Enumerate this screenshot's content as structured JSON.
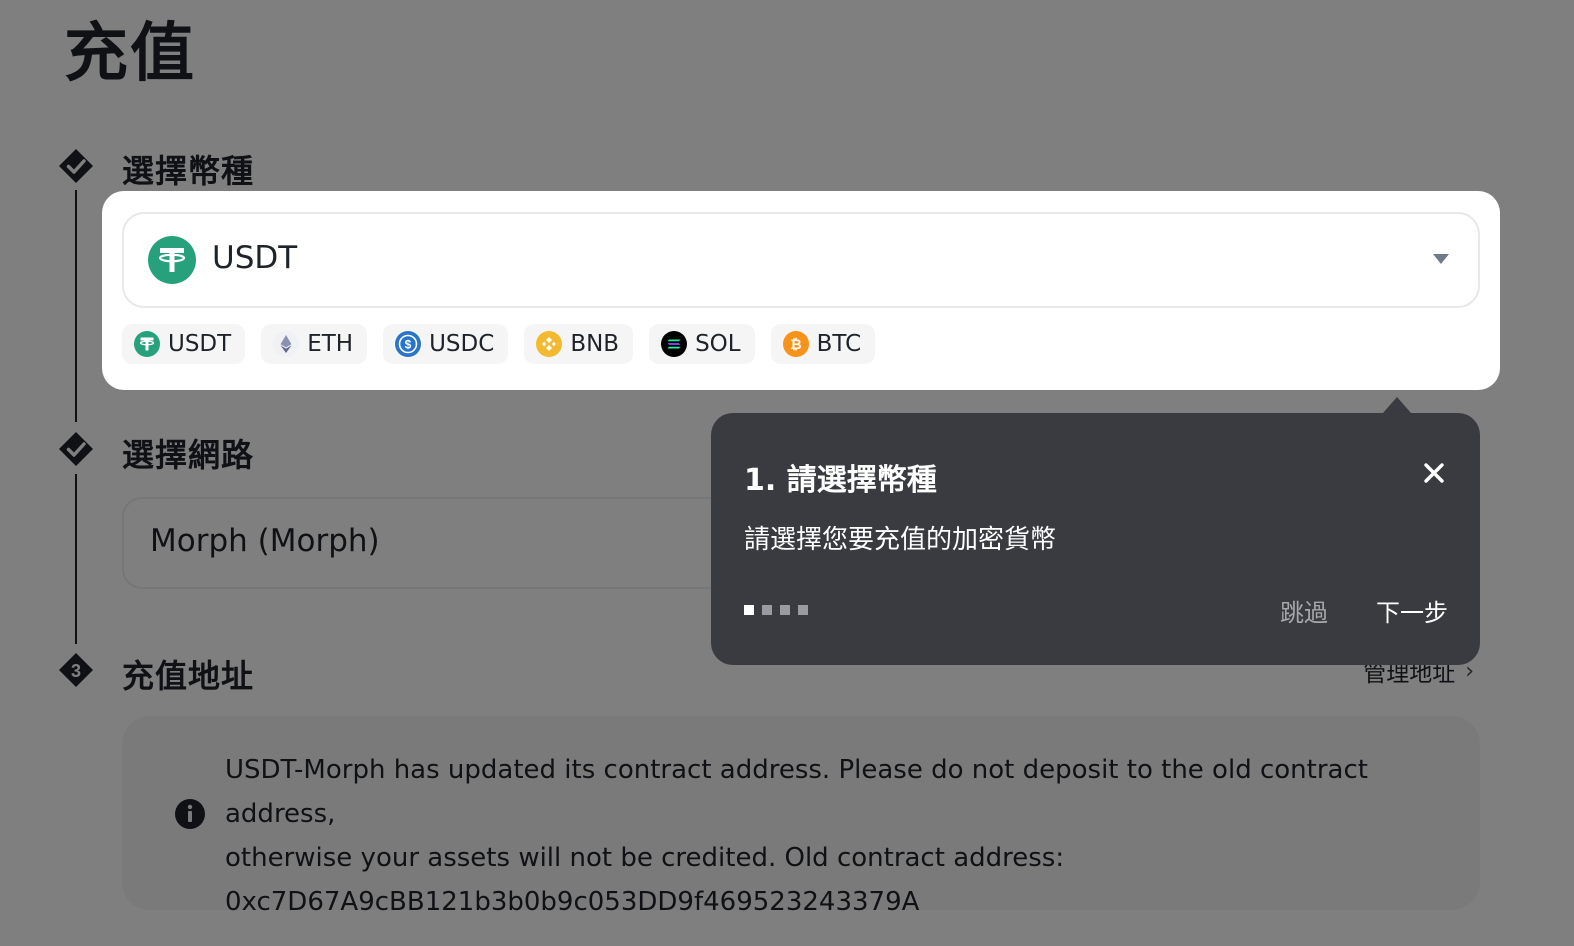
{
  "page": {
    "title": "充值"
  },
  "steps": [
    {
      "title": "選擇幣種",
      "state": "done"
    },
    {
      "title": "選擇網路",
      "state": "done"
    },
    {
      "title": "充值地址",
      "state": "pending",
      "number": "3"
    }
  ],
  "coin_select": {
    "selected": "USDT",
    "selected_icon": "usdt-icon",
    "quick_picks": [
      {
        "label": "USDT",
        "icon": "usdt-icon",
        "color": "#26a17b"
      },
      {
        "label": "ETH",
        "icon": "eth-icon",
        "color": "#8a92b2"
      },
      {
        "label": "USDC",
        "icon": "usdc-icon",
        "color": "#2775ca"
      },
      {
        "label": "BNB",
        "icon": "bnb-icon",
        "color": "#f3ba2f"
      },
      {
        "label": "SOL",
        "icon": "sol-icon",
        "color": "#000000"
      },
      {
        "label": "BTC",
        "icon": "btc-icon",
        "color": "#f7931a"
      }
    ]
  },
  "network_select": {
    "selected": "Morph (Morph)"
  },
  "address": {
    "manage_link": "管理地址",
    "notice_lines": [
      "USDT-Morph has updated its contract address. Please do not deposit to the old contract address,",
      "otherwise your assets will not be credited. Old contract address:",
      "0xc7D67A9cBB121b3b0b9c053DD9f469523243379A"
    ]
  },
  "tour": {
    "title": "1. 請選擇幣種",
    "body": "請選擇您要充值的加密貨幣",
    "skip_label": "跳過",
    "next_label": "下一步",
    "current_step": 1,
    "total_steps": 4
  },
  "colors": {
    "overlay": "rgba(0,0,0,0.5)",
    "tooltip_bg": "#3a3b40",
    "text_primary": "#1e2329"
  }
}
